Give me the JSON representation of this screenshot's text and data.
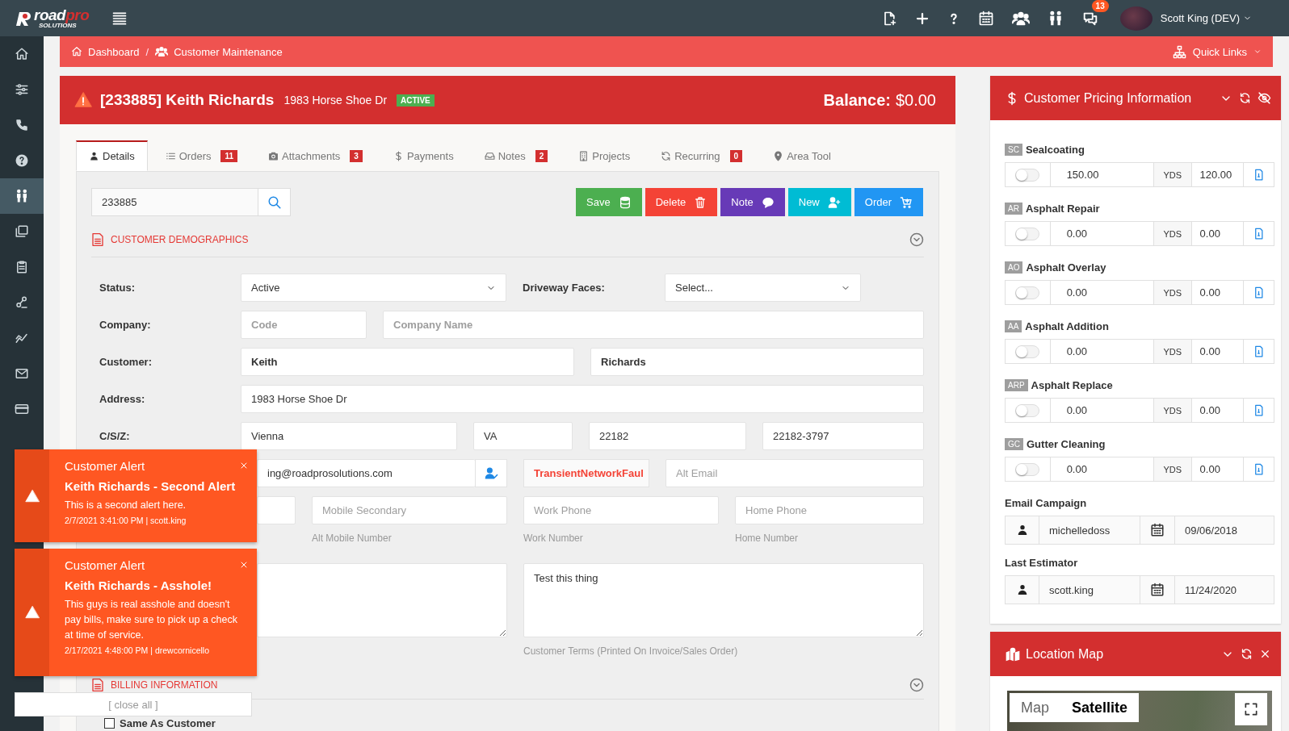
{
  "logo": {
    "name": "road",
    "accent": "pro",
    "tagline": "SOLUTIONS"
  },
  "top_bar": {
    "notification_count": "13",
    "user_name": "Scott King (DEV)"
  },
  "sidebar": {
    "items": [
      {
        "selected": false
      },
      {
        "selected": false
      },
      {
        "selected": false
      },
      {
        "selected": false
      },
      {
        "selected": true
      },
      {
        "selected": false
      },
      {
        "selected": false
      },
      {
        "selected": false
      },
      {
        "selected": false
      },
      {
        "selected": false
      },
      {
        "selected": false
      }
    ]
  },
  "breadcrumb": {
    "items": [
      "Dashboard",
      "Customer Maintenance"
    ],
    "separator": "/",
    "quick_links": "Quick Links"
  },
  "customer": {
    "title": "[233885] Keith Richards",
    "address": "1983 Horse Shoe Dr",
    "status": "ACTIVE",
    "balance_label": "Balance:",
    "balance": "$0.00"
  },
  "tabs": [
    {
      "label": "Details",
      "selected": true
    },
    {
      "label": "Orders",
      "count": "11",
      "selected": false
    },
    {
      "label": "Attachments",
      "count": "3",
      "selected": false
    },
    {
      "label": "Payments",
      "selected": false
    },
    {
      "label": "Notes",
      "count": "2",
      "selected": false
    },
    {
      "label": "Projects",
      "selected": false
    },
    {
      "label": "Recurring",
      "count": "0",
      "selected": false
    },
    {
      "label": "Area Tool",
      "selected": false
    }
  ],
  "search": {
    "value": "233885"
  },
  "actions": [
    {
      "label": "Save",
      "kind": "save"
    },
    {
      "label": "Delete",
      "kind": "delete"
    },
    {
      "label": "Note",
      "kind": "note"
    },
    {
      "label": "New",
      "kind": "new"
    },
    {
      "label": "Order",
      "kind": "order"
    }
  ],
  "demographics": {
    "title": "CUSTOMER DEMOGRAPHICS",
    "status_label": "Status:",
    "status": "Active",
    "driveway_label": "Driveway Faces:",
    "driveway": "Select...",
    "company_label": "Company:",
    "company_code_placeholder": "Code",
    "company_name_placeholder": "Company Name",
    "customer_label": "Customer:",
    "first_name": "Keith",
    "last_name": "Richards",
    "address_label": "Address:",
    "address": "1983 Horse Shoe Dr",
    "csz_label": "C/S/Z:",
    "city": "Vienna",
    "state": "VA",
    "zip": "22182",
    "zip4": "22182-3797",
    "email": "ing@roadprosolutions.com",
    "email_error": "TransientNetworkFaul",
    "alt_email_placeholder": "Alt Email",
    "mobile_secondary_placeholder": "Mobile Secondary",
    "alt_mobile_hint": "Alt Mobile Number",
    "work_phone_placeholder": "Work Phone",
    "work_hint": "Work Number",
    "home_phone_placeholder": "Home Phone",
    "home_hint": "Home Number",
    "terms": "Test this thing",
    "terms_hint": "Customer Terms (Printed On Invoice/Sales Order)"
  },
  "billing": {
    "title": "BILLING INFORMATION",
    "same_as_customer": {
      "label": "Same As Customer",
      "checked": false
    }
  },
  "pricing": {
    "title": "Customer Pricing Information",
    "items": [
      {
        "code": "SC",
        "name": "Sealcoating",
        "on": false,
        "price": "150.00",
        "unit": "YDS",
        "quantity": "120.00"
      },
      {
        "code": "AR",
        "name": "Asphalt Repair",
        "on": false,
        "price": "0.00",
        "unit": "YDS",
        "quantity": "0.00"
      },
      {
        "code": "AO",
        "name": "Asphalt Overlay",
        "on": false,
        "price": "0.00",
        "unit": "YDS",
        "quantity": "0.00"
      },
      {
        "code": "AA",
        "name": "Asphalt Addition",
        "on": false,
        "price": "0.00",
        "unit": "YDS",
        "quantity": "0.00"
      },
      {
        "code": "ARP",
        "name": "Asphalt Replace",
        "on": false,
        "price": "0.00",
        "unit": "YDS",
        "quantity": "0.00"
      },
      {
        "code": "GC",
        "name": "Gutter Cleaning",
        "on": false,
        "price": "0.00",
        "unit": "YDS",
        "quantity": "0.00"
      }
    ],
    "email_campaign": {
      "label": "Email Campaign",
      "user": "michelledoss",
      "date": "09/06/2018"
    },
    "last_estimator": {
      "label": "Last Estimator",
      "user": "scott.king",
      "date": "11/24/2020"
    }
  },
  "location_map": {
    "title": "Location Map",
    "map_types": [
      {
        "label": "Map",
        "selected": false
      },
      {
        "label": "Satellite",
        "selected": true
      }
    ]
  },
  "alerts": {
    "items": [
      {
        "title": "Customer Alert",
        "heading": "Keith Richards - Second Alert",
        "message": "This is a second alert here.",
        "meta": "2/7/2021 3:41:00 PM | scott.king"
      },
      {
        "title": "Customer Alert",
        "heading": "Keith Richards - Asshole!",
        "message": "This guys is real asshole and doesn't pay bills, make sure to pick up a check at time of service.",
        "meta": "2/17/2021 4:48:00 PM | drewcornicello"
      }
    ],
    "close_all": "[ close all ]"
  }
}
